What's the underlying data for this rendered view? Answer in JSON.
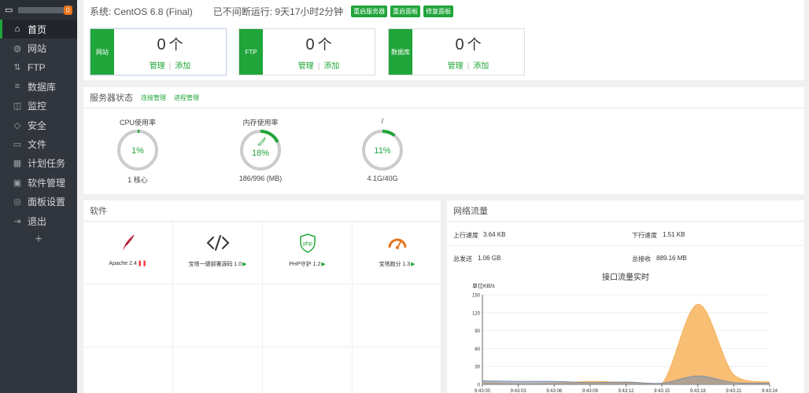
{
  "sidebar": {
    "notification_count": "0",
    "items": [
      {
        "label": "首页",
        "icon": "home-icon",
        "glyph": "⌂"
      },
      {
        "label": "网站",
        "icon": "globe-icon",
        "glyph": "◍"
      },
      {
        "label": "FTP",
        "icon": "ftp-icon",
        "glyph": "⇅"
      },
      {
        "label": "数据库",
        "icon": "database-icon",
        "glyph": "≡"
      },
      {
        "label": "监控",
        "icon": "monitor-icon",
        "glyph": "◫"
      },
      {
        "label": "安全",
        "icon": "shield-icon",
        "glyph": "◇"
      },
      {
        "label": "文件",
        "icon": "folder-icon",
        "glyph": "▭"
      },
      {
        "label": "计划任务",
        "icon": "calendar-icon",
        "glyph": "▦"
      },
      {
        "label": "软件管理",
        "icon": "apps-icon",
        "glyph": "▣"
      },
      {
        "label": "面板设置",
        "icon": "settings-icon",
        "glyph": "◎"
      },
      {
        "label": "退出",
        "icon": "logout-icon",
        "glyph": "⇥"
      }
    ],
    "add_label": "+"
  },
  "topbar": {
    "system": "系统: CentOS 6.8 (Final)",
    "uptime": "已不间断运行: 9天17小时2分钟",
    "buttons": [
      "重启服务器",
      "重启面板",
      "修复面板"
    ]
  },
  "stat_cards": [
    {
      "tag": "网站",
      "count": "0",
      "unit": "个",
      "manage": "管理",
      "add": "添加"
    },
    {
      "tag": "FTP",
      "count": "0",
      "unit": "个",
      "manage": "管理",
      "add": "添加"
    },
    {
      "tag": "数据库",
      "count": "0",
      "unit": "个",
      "manage": "管理",
      "add": "添加"
    }
  ],
  "server_status": {
    "title": "服务器状态",
    "links": [
      "连接管理",
      "进程管理"
    ],
    "gauges": [
      {
        "label": "CPU使用率",
        "value": "1%",
        "percent": 1,
        "sub": "1 核心"
      },
      {
        "label": "内存使用率",
        "value": "18%",
        "percent": 18,
        "sub": "186/996 (MB)"
      },
      {
        "label": "/",
        "value": "11%",
        "percent": 11,
        "sub": "4.1G/40G"
      }
    ]
  },
  "software": {
    "title": "软件",
    "items": [
      {
        "name": "Apache 2.4",
        "icon": "apache-feather-icon",
        "state": "stopped"
      },
      {
        "name": "宝塔一键部署源码 1.0",
        "icon": "code-icon",
        "state": "running"
      },
      {
        "name": "PHP守护 1.2",
        "icon": "php-shield-icon",
        "state": "running"
      },
      {
        "name": "宝塔跑分 1.3",
        "icon": "speedometer-icon",
        "state": "running"
      }
    ]
  },
  "network": {
    "title": "网络流量",
    "upload_label": "上行速度",
    "upload_value": "3.64 KB",
    "download_label": "下行速度",
    "download_value": "1.51 KB",
    "sent_label": "总发送",
    "sent_value": "1.06 GB",
    "recv_label": "总接收",
    "recv_value": "889.16 MB"
  },
  "chart_data": {
    "type": "area",
    "title": "接口流量实时",
    "ylabel": "单位KB/s",
    "ylim": [
      0,
      150
    ],
    "yticks": [
      0,
      30,
      60,
      90,
      120,
      150
    ],
    "x": [
      "9:43:00",
      "9:43:03",
      "9:43:06",
      "9:43:09",
      "9:43:12",
      "9:43:15",
      "9:43:18",
      "9:43:21",
      "9:43:24"
    ],
    "series": [
      {
        "color": "#f7b35c",
        "values": [
          3,
          1,
          2,
          5,
          3,
          1,
          134,
          16,
          4
        ]
      },
      {
        "color": "#7f8fa8",
        "values": [
          6,
          5,
          5,
          3,
          4,
          2,
          14,
          3,
          2
        ]
      }
    ]
  }
}
